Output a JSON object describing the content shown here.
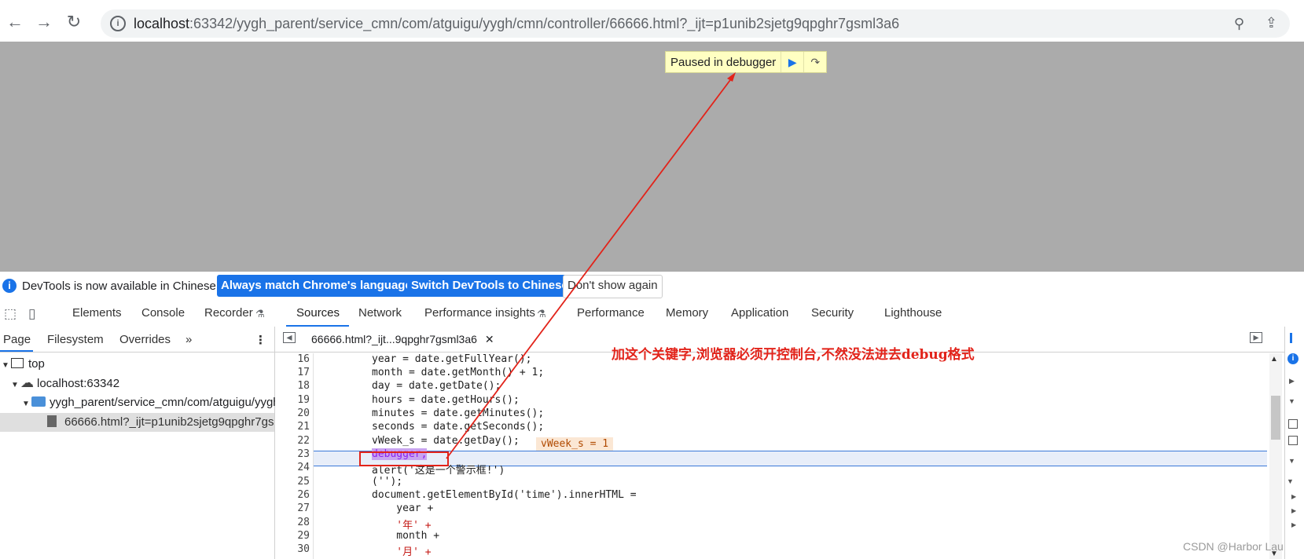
{
  "browser": {
    "url_host": "localhost",
    "url_rest": ":63342/yygh_parent/service_cmn/com/atguigu/yygh/cmn/controller/66666.html?_ijt=p1unib2sjetg9qpghr7gsml3a6"
  },
  "page": {
    "paused_label": "Paused in debugger"
  },
  "infobar": {
    "message": "DevTools is now available in Chinese!",
    "btn_match": "Always match Chrome's language",
    "btn_switch": "Switch DevTools to Chinese",
    "btn_dismiss": "Don't show again"
  },
  "devtools": {
    "tabs": [
      "Elements",
      "Console",
      "Recorder",
      "Sources",
      "Network",
      "Performance insights",
      "Performance",
      "Memory",
      "Application",
      "Security",
      "Lighthouse"
    ],
    "active_tab": "Sources"
  },
  "navigator": {
    "tabs": [
      "Page",
      "Filesystem",
      "Overrides"
    ],
    "tree": {
      "top": "top",
      "host": "localhost:63342",
      "folder": "yygh_parent/service_cmn/com/atguigu/yygh",
      "file": "66666.html?_ijt=p1unib2sjetg9qpghr7gs"
    }
  },
  "editor": {
    "file_tab": "66666.html?_ijt...9qpghr7gsml3a6",
    "inline_value": "vWeek_s = 1",
    "lines": [
      {
        "n": "16",
        "text": "year = date.getFullYear();"
      },
      {
        "n": "17",
        "text": "month = date.getMonth() + 1;"
      },
      {
        "n": "18",
        "text": "day = date.getDate();"
      },
      {
        "n": "19",
        "text": "hours = date.getHours();"
      },
      {
        "n": "20",
        "text": "minutes = date.getMinutes();"
      },
      {
        "n": "21",
        "text": "seconds = date.getSeconds();"
      },
      {
        "n": "22",
        "text": "vWeek_s = date.getDay();"
      },
      {
        "n": "23",
        "text": "debugger;"
      },
      {
        "n": "24",
        "text": "alert('这是一个警示框!')"
      },
      {
        "n": "25",
        "text": "('');"
      },
      {
        "n": "26",
        "text": "document.getElementById('time').innerHTML ="
      },
      {
        "n": "27",
        "text": "    year +"
      },
      {
        "n": "28",
        "text": "    '年' +"
      },
      {
        "n": "29",
        "text": "    month +"
      },
      {
        "n": "30",
        "text": "    '月' +"
      }
    ]
  },
  "annotation": "加这个关键字,浏览器必须开控制台,不然没法进去debug格式",
  "watermark": "CSDN @Harbor Lau",
  "colors": {
    "accent": "#1a73e8",
    "annotation_red": "#e2231a",
    "page_gray": "#ababab",
    "paused_bg": "#ffffc2"
  }
}
